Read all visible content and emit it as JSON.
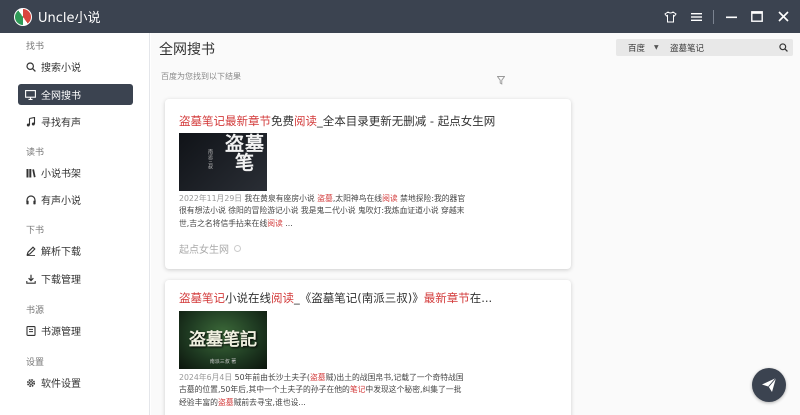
{
  "app": {
    "title": "Uncle小说"
  },
  "sidebar": {
    "sections": [
      {
        "label": "找书",
        "items": [
          {
            "label": "搜索小说",
            "icon": "search-icon"
          },
          {
            "label": "全网搜书",
            "icon": "monitor-icon",
            "active": true
          },
          {
            "label": "寻找有声",
            "icon": "music-note-icon"
          }
        ]
      },
      {
        "label": "读书",
        "items": [
          {
            "label": "小说书架",
            "icon": "books-icon"
          },
          {
            "label": "有声小说",
            "icon": "headphones-icon"
          }
        ]
      },
      {
        "label": "下书",
        "items": [
          {
            "label": "解析下载",
            "icon": "pen-icon"
          },
          {
            "label": "下载管理",
            "icon": "download-icon"
          }
        ]
      },
      {
        "label": "书源",
        "items": [
          {
            "label": "书源管理",
            "icon": "book-source-icon"
          }
        ]
      },
      {
        "label": "设置",
        "items": [
          {
            "label": "软件设置",
            "icon": "gear-icon"
          }
        ]
      }
    ]
  },
  "main": {
    "title": "全网搜书",
    "search": {
      "engine": "百度",
      "query": "盗墓笔记"
    },
    "result_count": "百度为您找到以下结果",
    "results": [
      {
        "title": {
          "p1": "盗墓笔记最新章节",
          "p2": "免费",
          "p3": "阅读",
          "p4": "_全本目录更新无删减 - 起点女生网"
        },
        "snippet": {
          "date": "2022年11月29日",
          "t1": " 我在黄泉有座房小说 ",
          "h1": "盗墓",
          "t2": ",太阳神鸟在线",
          "h2": "阅读",
          "t3": " 禁地探险:我的器官很有想法小说 徐阳的冒险游记小说 我是鬼二代小说 鬼吹灯:我炼血证道小说 穿越末世,吉之名将信手拈来在线",
          "h3": "阅读",
          "t4": " ..."
        },
        "source": "起点女生网",
        "cover": {
          "big": "盗墓笔",
          "small": "南派三叔"
        }
      },
      {
        "title": {
          "p1": "盗墓笔记",
          "p2": "小说在线",
          "p3": "阅读",
          "p4": "_《盗墓笔记(南派三叔)》",
          "p5": "最新章节",
          "p6": "在..."
        },
        "snippet": {
          "date": "2024年6月4日",
          "t1": " 50年前由长沙土夫子(",
          "h1": "盗墓",
          "t2": "贼)出土的战国帛书,记载了一个奇特战国古墓的位置,50年后,其中一个土夫子的孙子在他的",
          "h2": "笔记",
          "t3": "中发现这个秘密,纠集了一批经验丰富的",
          "h3": "盗墓",
          "t4": "贼前去寻宝,谁也设..."
        },
        "cover": {
          "big": "盗墓笔記",
          "small": "南派三叔 著"
        }
      }
    ]
  },
  "colors": {
    "titlebar": "#3b4350",
    "highlight": "#d33b3b",
    "active_nav": "#3b4350"
  }
}
